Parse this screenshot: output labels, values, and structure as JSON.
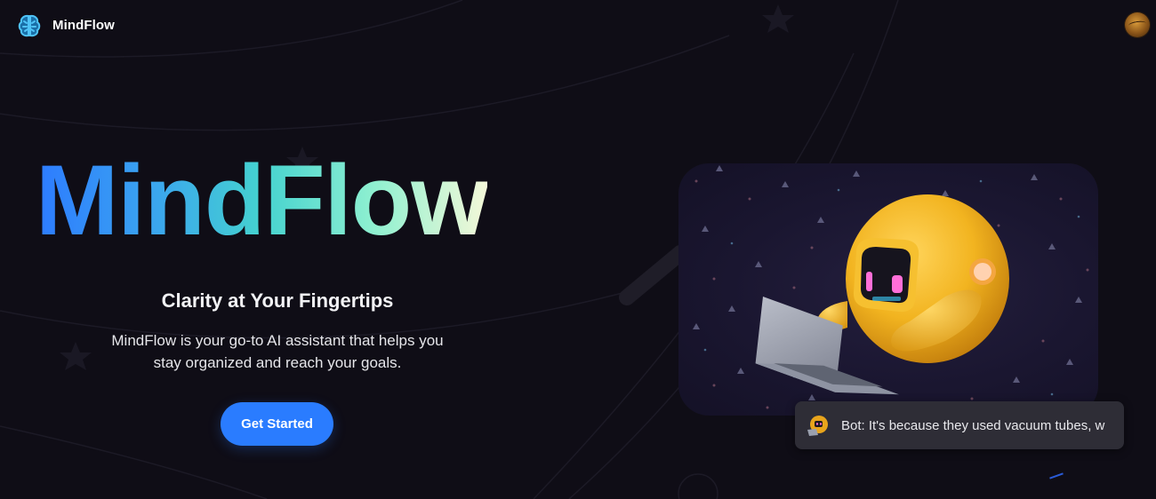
{
  "brand": {
    "name": "MindFlow",
    "logo_icon": "brain-icon",
    "accent_color": "#2a7cff"
  },
  "hero": {
    "title": "MindFlow",
    "subtitle": "Clarity at Your Fingertips",
    "description_line1": "MindFlow is your go-to AI assistant that helps you",
    "description_line2": "stay organized and reach your goals.",
    "cta_label": "Get Started"
  },
  "illustration": {
    "icon": "robot-with-laptop-illustration"
  },
  "chat": {
    "avatar_icon": "robot-avatar-icon",
    "message": "Bot: It's because they used vacuum tubes, w"
  },
  "user": {
    "avatar_icon": "user-avatar"
  }
}
